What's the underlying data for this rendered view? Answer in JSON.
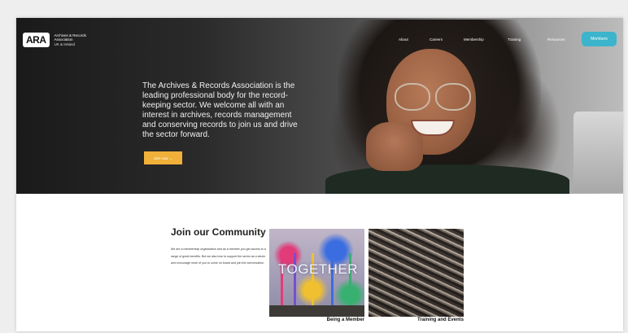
{
  "header": {
    "logo_abbr": "ARA",
    "logo_name": "Archives & Records Association",
    "logo_region": "UK & Ireland",
    "nav": [
      "About",
      "Careers",
      "Membership",
      "Training",
      "Resources"
    ],
    "cta": "Members"
  },
  "hero": {
    "text": "The Archives & Records Association is the leading professional body for the record-keeping sector. We welcome all with an interest in archives, records management and conserving records to join us and drive the sector forward.",
    "button": "Join now →"
  },
  "community": {
    "title": "Join our Community",
    "paragraph": "We are a membership organisation and as a member you get access to a range of great benefits. But we also love to support the sector as a whole and encourage more of you to come on board and join the conversation.",
    "cards": [
      {
        "image_text": "TOGETHER",
        "caption": "Being a Member"
      },
      {
        "caption": "Training and Events"
      }
    ]
  },
  "colors": {
    "accent": "#3cb4cc",
    "button": "#f0b03a"
  }
}
